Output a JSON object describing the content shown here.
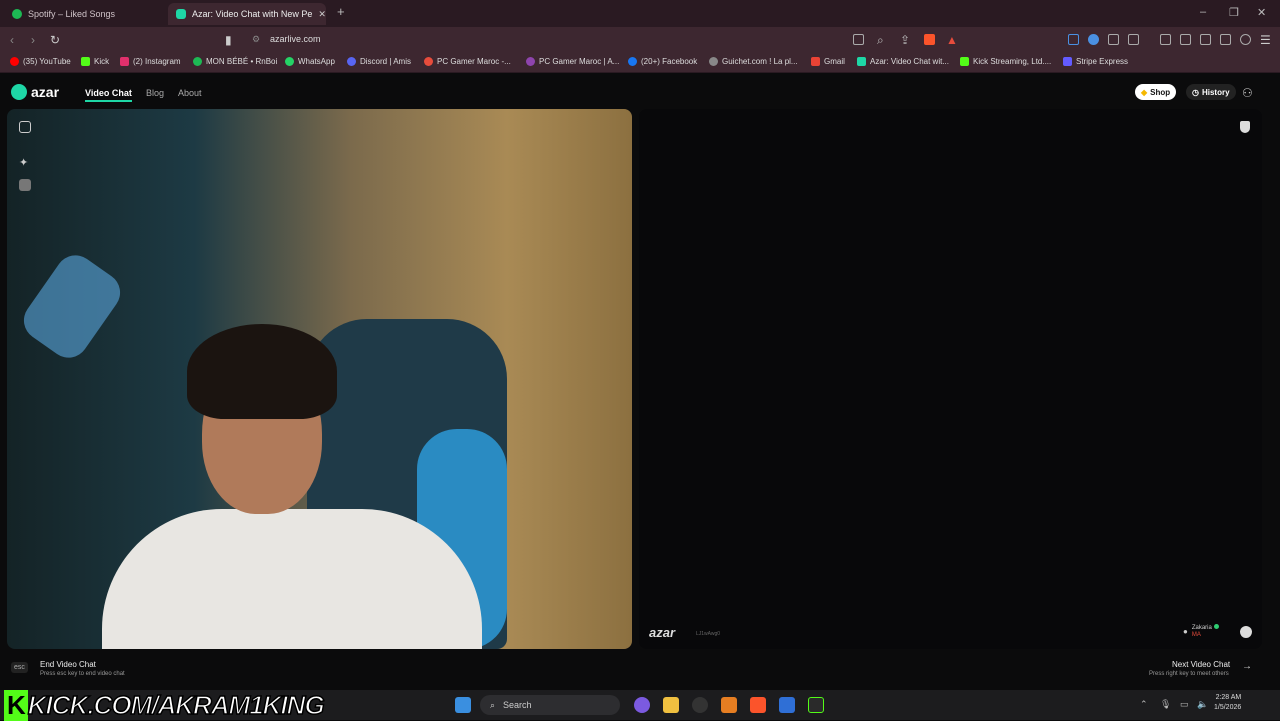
{
  "browser": {
    "tabs": [
      {
        "label": "Spotify – Liked Songs",
        "active": false,
        "color": "#1db954"
      },
      {
        "label": "Azar: Video Chat with New Pe",
        "active": true,
        "color": "#1ed7a6"
      }
    ],
    "url": "azarlive.com",
    "bookmarks": [
      {
        "label": "(35) YouTube",
        "color": "#ff0000"
      },
      {
        "label": "Kick",
        "color": "#53fc18"
      },
      {
        "label": "(2) Instagram",
        "color": "#e1306c"
      },
      {
        "label": "MON BÉBÉ • RnBoi",
        "color": "#1db954"
      },
      {
        "label": "WhatsApp",
        "color": "#25d366"
      },
      {
        "label": "Discord | Amis",
        "color": "#5865f2"
      },
      {
        "label": "PC Gamer Maroc -...",
        "color": "#e74c3c"
      },
      {
        "label": "PC Gamer Maroc | A...",
        "color": "#8e44ad"
      },
      {
        "label": "(20+) Facebook",
        "color": "#1877f2"
      },
      {
        "label": "Guichet.com ! La pl...",
        "color": "#888888"
      },
      {
        "label": "Gmail",
        "color": "#ea4335"
      },
      {
        "label": "Azar: Video Chat wit...",
        "color": "#1ed7a6"
      },
      {
        "label": "Kick Streaming, Ltd....",
        "color": "#53fc18"
      },
      {
        "label": "Stripe Express",
        "color": "#635bff"
      }
    ]
  },
  "site": {
    "logo": "azar",
    "nav": [
      "Video Chat",
      "Blog",
      "About"
    ],
    "shop_label": "Shop",
    "history_label": "History"
  },
  "video": {
    "watermark": "azar",
    "watermark_sub": "LJ1wAwg0",
    "partner_name": "Zakaria",
    "partner_country": "MA"
  },
  "controls": {
    "esc_key": "esc",
    "end_title": "End Video Chat",
    "end_sub": "Press esc key to end video chat",
    "next_title": "Next Video Chat",
    "next_sub": "Press right key to meet others"
  },
  "overlay": {
    "k": "K",
    "text": "KICK.COM/AKRAM1KING"
  },
  "taskbar": {
    "search_label": "Search",
    "time": "2:28 AM",
    "date": "1/5/2026"
  },
  "colors": {
    "accent": "#1ed7a6",
    "tab_bg": "#2a1a22",
    "toolbar_bg": "#3d2730",
    "kick_green": "#53fc18"
  }
}
